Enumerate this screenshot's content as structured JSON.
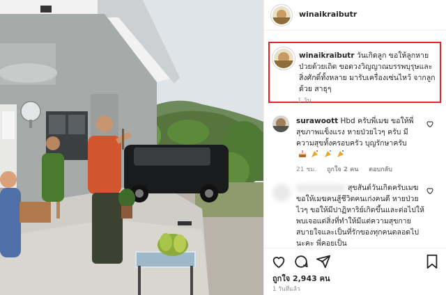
{
  "post": {
    "username": "winaikraibutr"
  },
  "caption": {
    "username": "winaikraibutr",
    "text": "วันเกิดลูก ขอให้ลูกหายป่วยด้วยเถิด ขอดวงวิญญาณบรรพบุรุษและสิ่งศักดิ์ทั้งหลาย มารับเครื่องเซ่นไหว้ จากลูกด้วย สาธุๆ",
    "time": "1 วัน"
  },
  "comments": [
    {
      "username": "surawoott",
      "text": "Hbd ครับพี่เมฆ ขอให้พี่สุขภาพแข็งแรง หายป่วยไวๆ ครับ มีความสุขทั้งครอบครัว บุญรักษาครับ",
      "time": "21 ชม.",
      "likes": "ถูกใจ 2 คน",
      "reply": "ตอบกลับ"
    },
    {
      "username": "",
      "text": "สุขสันต์วันเกิดครับเมฆ ขอให้เมฆคนสู้ชีวิตคนเก่งคนดี หายป่วยไวๆ ขอให้มีปาฏิหาริย์เกิดขึ้นและต่อไปให้พบเจอแต่สิ่งที่ทำให้มีแต่ความสุขกายสบายใจและเป็นที่รักของทุกคนตลอดไปนะคะ พี่คอยเป็น"
    }
  ],
  "footer": {
    "likes": "ถูกใจ 2,943 คน",
    "posted": "1 วันที่แล้ว"
  },
  "colors": {
    "highlight": "#e0232b",
    "text": "#262626",
    "muted": "#8e8e8e"
  },
  "icons": [
    "heart-icon",
    "comment-icon",
    "share-icon",
    "bookmark-icon",
    "cake-emoji",
    "party-emoji"
  ]
}
